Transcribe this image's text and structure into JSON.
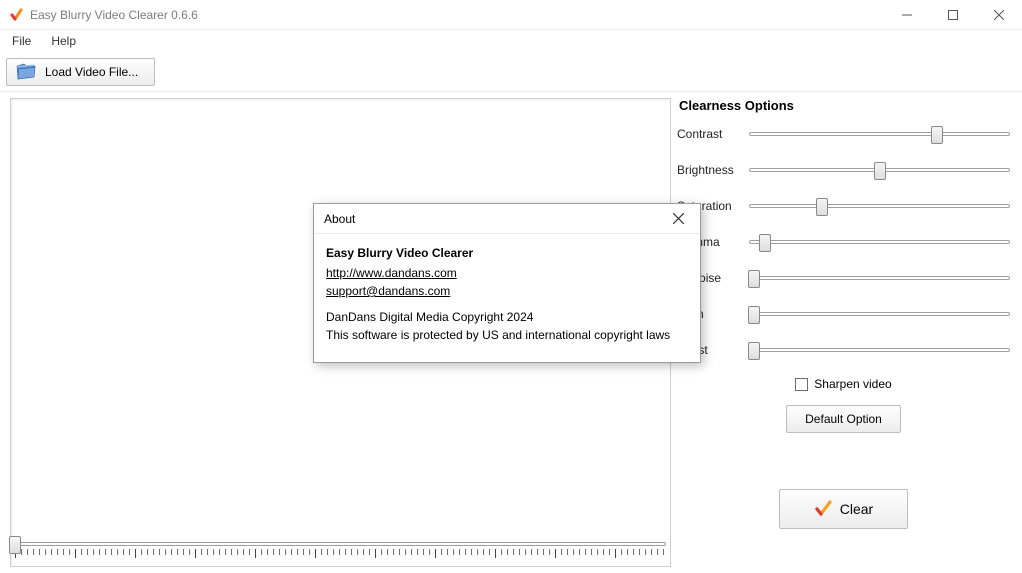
{
  "window": {
    "title": "Easy Blurry Video Clearer 0.6.6",
    "controls": {
      "minimize": "Minimize",
      "maximize": "Maximize",
      "close": "Close"
    }
  },
  "menu": {
    "file": "File",
    "help": "Help"
  },
  "toolbar": {
    "load_video": "Load Video File..."
  },
  "timeline": {
    "position_pct": 0
  },
  "options": {
    "title": "Clearness Options",
    "sliders": [
      {
        "label": "Contrast",
        "value_pct": 72
      },
      {
        "label": "Brightness",
        "value_pct": 50
      },
      {
        "label": "Saturation",
        "value_pct": 28
      },
      {
        "label": "Gamma",
        "value_pct": 6
      },
      {
        "label": "Denoise",
        "value_pct": 2
      },
      {
        "label": "Align",
        "value_pct": 2
      },
      {
        "label": "Boost",
        "value_pct": 2
      }
    ],
    "sharpen_label": "Sharpen video",
    "sharpen_checked": false,
    "default_btn": "Default Option",
    "clear_btn": "Clear"
  },
  "about": {
    "title": "About",
    "heading": "Easy Blurry Video Clearer",
    "website": "http://www.dandans.com",
    "email": "support@dandans.com",
    "copyright": "DanDans Digital Media Copyright 2024",
    "legal": "This software is protected by US and international copyright laws"
  }
}
